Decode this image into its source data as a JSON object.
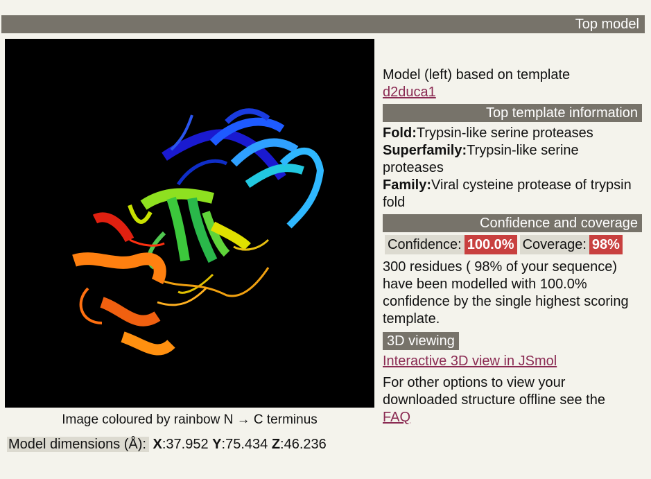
{
  "header": {
    "title": "Top model"
  },
  "viewer": {
    "caption": "Image coloured by rainbow N → C terminus",
    "dims_label": "Model dimensions (Å):",
    "x_label": "X",
    "x_value": ":37.952",
    "y_label": "Y",
    "y_value": ":75.434",
    "z_label": "Z",
    "z_value": ":46.236"
  },
  "model": {
    "based_on_text": "Model (left) based on template",
    "template_link": "d2duca1"
  },
  "template_info": {
    "title": "Top template information",
    "fold_label": "Fold:",
    "fold_value": "Trypsin-like serine proteases",
    "superfamily_label": "Superfamily:",
    "superfamily_value": "Trypsin-like serine proteases",
    "family_label": "Family:",
    "family_value": "Viral cysteine protease of trypsin fold"
  },
  "confidence": {
    "title": "Confidence and coverage",
    "confidence_label": "Confidence:",
    "confidence_value": "100.0%",
    "coverage_label": "Coverage:",
    "coverage_value": "98%",
    "summary": "300 residues ( 98% of your sequence) have been modelled with 100.0% confidence by the single highest scoring template."
  },
  "viewing": {
    "title": "3D viewing",
    "jsmol_link": "Interactive 3D view in JSmol",
    "offline_text": "For other options to view your downloaded structure offline see the",
    "faq_link": "FAQ"
  },
  "colors": {
    "bar": "#77736a",
    "badge": "#c8403f",
    "link": "#8a2a52",
    "background": "#f4f3ec"
  }
}
